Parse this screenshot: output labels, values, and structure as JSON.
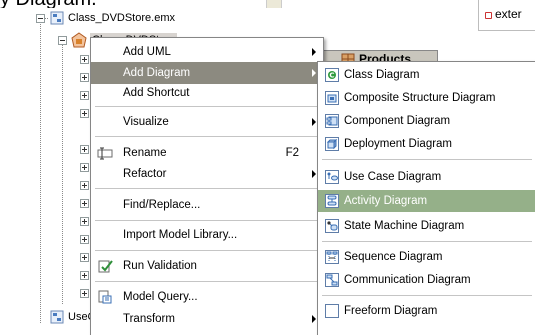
{
  "caption": {
    "text": "y Diagram."
  },
  "tree": {
    "items": [
      {
        "label": "Class_DVDStore.emx"
      },
      {
        "label": "Class_DVDStore"
      },
      {
        "label": "UseCase"
      }
    ]
  },
  "right_panel": {
    "label": "exter"
  },
  "products_tab": {
    "label": "Products"
  },
  "context_menu": {
    "items": [
      {
        "label": "Add UML",
        "has_submenu": true
      },
      {
        "label": "Add Diagram",
        "has_submenu": true,
        "highlighted": true
      },
      {
        "label": "Add Shortcut"
      },
      {
        "label": "Visualize",
        "has_submenu": true
      },
      {
        "label": "Rename",
        "shortcut": "F2"
      },
      {
        "label": "Refactor",
        "has_submenu": true
      },
      {
        "label": "Find/Replace..."
      },
      {
        "label": "Import Model Library..."
      },
      {
        "label": "Run Validation"
      },
      {
        "label": "Model Query..."
      },
      {
        "label": "Transform",
        "has_submenu": true
      }
    ]
  },
  "diagram_submenu": {
    "items": [
      {
        "label": "Class Diagram",
        "icon": "class-diagram-icon"
      },
      {
        "label": "Composite Structure Diagram",
        "icon": "composite-structure-diagram-icon"
      },
      {
        "label": "Component Diagram",
        "icon": "component-diagram-icon"
      },
      {
        "label": "Deployment Diagram",
        "icon": "deployment-diagram-icon"
      },
      {
        "label": "Use Case Diagram",
        "icon": "use-case-diagram-icon"
      },
      {
        "label": "Activity Diagram",
        "icon": "activity-diagram-icon",
        "highlighted": true
      },
      {
        "label": "State Machine Diagram",
        "icon": "state-machine-diagram-icon"
      },
      {
        "label": "Sequence Diagram",
        "icon": "sequence-diagram-icon"
      },
      {
        "label": "Communication Diagram",
        "icon": "communication-diagram-icon"
      },
      {
        "label": "Freeform Diagram",
        "icon": "freeform-diagram-icon"
      }
    ]
  }
}
